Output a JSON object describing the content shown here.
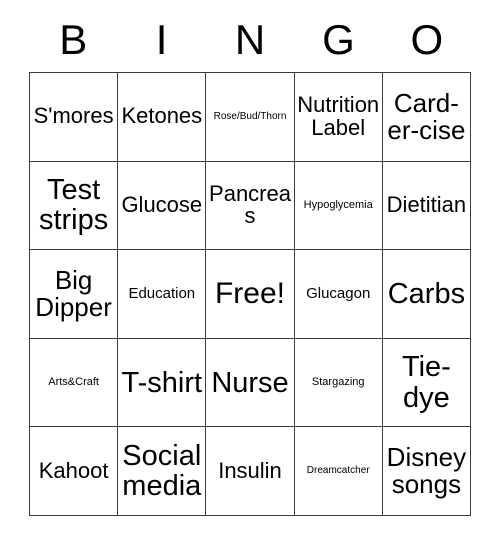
{
  "card": {
    "title": "BINGO",
    "header": [
      {
        "letter": "B"
      },
      {
        "letter": "I"
      },
      {
        "letter": "N"
      },
      {
        "letter": "G"
      },
      {
        "letter": "O"
      }
    ],
    "free_space_label": "Free!",
    "colors": {
      "background": "#ffffff",
      "text": "#000000",
      "border": "#3c3c3c"
    },
    "rows": [
      [
        {
          "label": "S'mores",
          "size": "md",
          "free": false
        },
        {
          "label": "Ketones",
          "size": "md",
          "free": false
        },
        {
          "label": "Rose/Bud/Thorn",
          "size": "xxs",
          "free": false
        },
        {
          "label": "Nutrition Label",
          "size": "md",
          "free": false
        },
        {
          "label": "Card-er-cise",
          "size": "lg",
          "free": false
        }
      ],
      [
        {
          "label": "Test strips",
          "size": "xl",
          "free": false
        },
        {
          "label": "Glucose",
          "size": "md",
          "free": false
        },
        {
          "label": "Pancreas",
          "size": "md",
          "free": false
        },
        {
          "label": "Hypoglycemia",
          "size": "xs",
          "free": false
        },
        {
          "label": "Dietitian",
          "size": "md",
          "free": false
        }
      ],
      [
        {
          "label": "Big Dipper",
          "size": "lg",
          "free": false
        },
        {
          "label": "Education",
          "size": "sm",
          "free": false
        },
        {
          "label": "Free!",
          "size": "xl",
          "free": true
        },
        {
          "label": "Glucagon",
          "size": "sm",
          "free": false
        },
        {
          "label": "Carbs",
          "size": "xl",
          "free": false
        }
      ],
      [
        {
          "label": "Arts&Craft",
          "size": "xs",
          "free": false
        },
        {
          "label": "T-shirt",
          "size": "xl",
          "free": false
        },
        {
          "label": "Nurse",
          "size": "xl",
          "free": false
        },
        {
          "label": "Stargazing",
          "size": "xs",
          "free": false
        },
        {
          "label": "Tie-dye",
          "size": "xl",
          "free": false
        }
      ],
      [
        {
          "label": "Kahoot",
          "size": "md",
          "free": false
        },
        {
          "label": "Social media",
          "size": "xl",
          "free": false
        },
        {
          "label": "Insulin",
          "size": "md",
          "free": false
        },
        {
          "label": "Dreamcatcher",
          "size": "xxs",
          "free": false
        },
        {
          "label": "Disney songs",
          "size": "lg",
          "free": false
        }
      ]
    ]
  }
}
